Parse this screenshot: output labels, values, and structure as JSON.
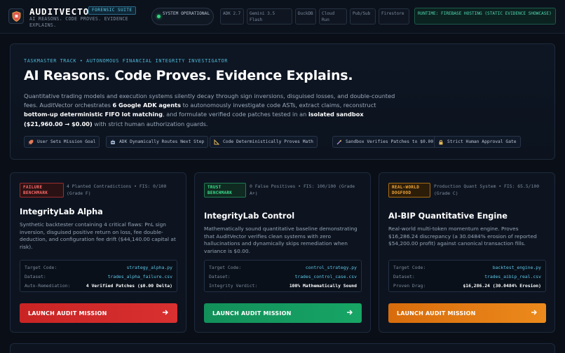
{
  "header": {
    "brand": "AUDITVECTOR",
    "brand_badge": "FORENSIC SUITE",
    "tagline": "AI REASONS. CODE PROVES. EVIDENCE EXPLAINS.",
    "system_status": "SYSTEM OPERATIONAL",
    "tech_stack": [
      "ADK 2.7",
      "Gemini 3.5 Flash",
      "DuckDB",
      "Cloud Run",
      "Pub/Sub",
      "Firestore"
    ],
    "runtime": "RUNTIME: FIREBASE HOSTING (STATIC EVIDENCE SHOWCASE)"
  },
  "hero": {
    "eyebrow": "TASKMASTER TRACK • AUTONOMOUS FINANCIAL INTEGRITY INVESTIGATOR",
    "title": "AI Reasons. Code Proves. Evidence Explains.",
    "desc_1": "Quantitative trading models and execution systems silently decay through sign inversions, disguised losses, and double-counted fees. AuditVector orchestrates ",
    "desc_b1": "6 Google ADK agents",
    "desc_2": " to autonomously investigate code ASTs, extract claims, reconstruct ",
    "desc_b2": "bottom-up deterministic FIFO lot matching",
    "desc_3": ", and formulate verified code patches tested in an ",
    "desc_b3": "isolated sandbox ($21,960.00 → $0.00)",
    "desc_4": " with strict human authorization guards.",
    "flow": [
      "User Sets Mission Goal",
      "ADK Dynamically Routes Next Step",
      "Code Deterministically Proves Math",
      "Sandbox Verifies Patches to $0.00",
      "Strict Human Approval Gate"
    ]
  },
  "cards": [
    {
      "badge": "FAILURE BENCHMARK",
      "meta": "4 Planted Contradictions • FIS: 0/100 (Grade F)",
      "title": "IntegrityLab Alpha",
      "desc": "Synthetic backtester containing 4 critical flaws: PnL sign inversion, disguised positive return on loss, fee double-deduction, and configuration fee drift ($44,140.00 capital at risk).",
      "rows": [
        {
          "k": "Target Code:",
          "v": "strategy_alpha.py"
        },
        {
          "k": "Dataset:",
          "v": "trades_alpha_failure.csv"
        },
        {
          "k": "Auto-Remediation:",
          "v": "4 Verified Patches ($0.00 Delta)"
        }
      ],
      "launch": "LAUNCH AUDIT MISSION"
    },
    {
      "badge": "TRUST BENCHMARK",
      "meta": "0 False Positives • FIS: 100/100 (Grade A+)",
      "title": "IntegrityLab Control",
      "desc": "Mathematically sound quantitative baseline demonstrating that AuditVector verifies clean systems with zero hallucinations and dynamically skips remediation when variance is $0.00.",
      "rows": [
        {
          "k": "Target Code:",
          "v": "control_strategy.py"
        },
        {
          "k": "Dataset:",
          "v": "trades_control_case.csv"
        },
        {
          "k": "Integrity Verdict:",
          "v": "100% Mathematically Sound"
        }
      ],
      "launch": "LAUNCH AUDIT MISSION"
    },
    {
      "badge": "REAL-WORLD DOGFOOD",
      "meta": "Production Quant System • FIS: 65.5/100 (Grade C)",
      "title": "AI-BIP Quantitative Engine",
      "desc": "Real-world multi-token momentum engine. Proves $16,286.24 discrepancy (a 30.0484% erosion of reported $54,200.00 profit) against canonical transaction fills.",
      "rows": [
        {
          "k": "Target Code:",
          "v": "backtest_engine.py"
        },
        {
          "k": "Dataset:",
          "v": "trades_aibip_real.csv"
        },
        {
          "k": "Proven Drag:",
          "v": "$16,286.24 (30.0484% Erosion)"
        }
      ],
      "launch": "LAUNCH AUDIT MISSION"
    }
  ],
  "colors": {
    "accent_cyan": "#4fb8d8",
    "fail_red": "#d93030",
    "trust_green": "#17a565",
    "real_orange": "#ec8a1c"
  }
}
